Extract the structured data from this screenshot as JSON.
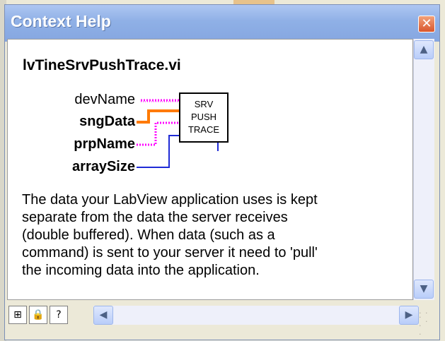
{
  "window": {
    "title": "Context Help"
  },
  "vi": {
    "name": "lvTineSrvPushTrace.vi",
    "block_label": [
      "SRV",
      "PUSH",
      "TRACE"
    ],
    "terminals": [
      {
        "label": "devName",
        "bold": false,
        "wire_color": "#ff00ff"
      },
      {
        "label": "sngData",
        "bold": true,
        "wire_color": "#ff7a00"
      },
      {
        "label": "prpName",
        "bold": true,
        "wire_color": "#ff00ff"
      },
      {
        "label": "arraySize",
        "bold": true,
        "wire_color": "#1f2bd6"
      }
    ]
  },
  "description": {
    "lines": [
      "The data your LabView application uses is kept",
      "separate from the data the server receives",
      "(double buffered).  When data (such as a",
      "command) is sent to your server it need to 'pull'",
      "the incoming data into the application."
    ]
  },
  "toolbar": {
    "buttons": [
      {
        "name": "show-block-diagram-icon",
        "glyph": "⊞"
      },
      {
        "name": "lock-icon",
        "glyph": "🔒"
      },
      {
        "name": "detailed-help-icon",
        "glyph": "?"
      }
    ]
  },
  "colors": {
    "titlebar": "#8fb0e6",
    "close": "#d9562c",
    "wire_string": "#ff00ff",
    "wire_orange": "#ff7a00",
    "wire_blue": "#1f2bd6"
  }
}
